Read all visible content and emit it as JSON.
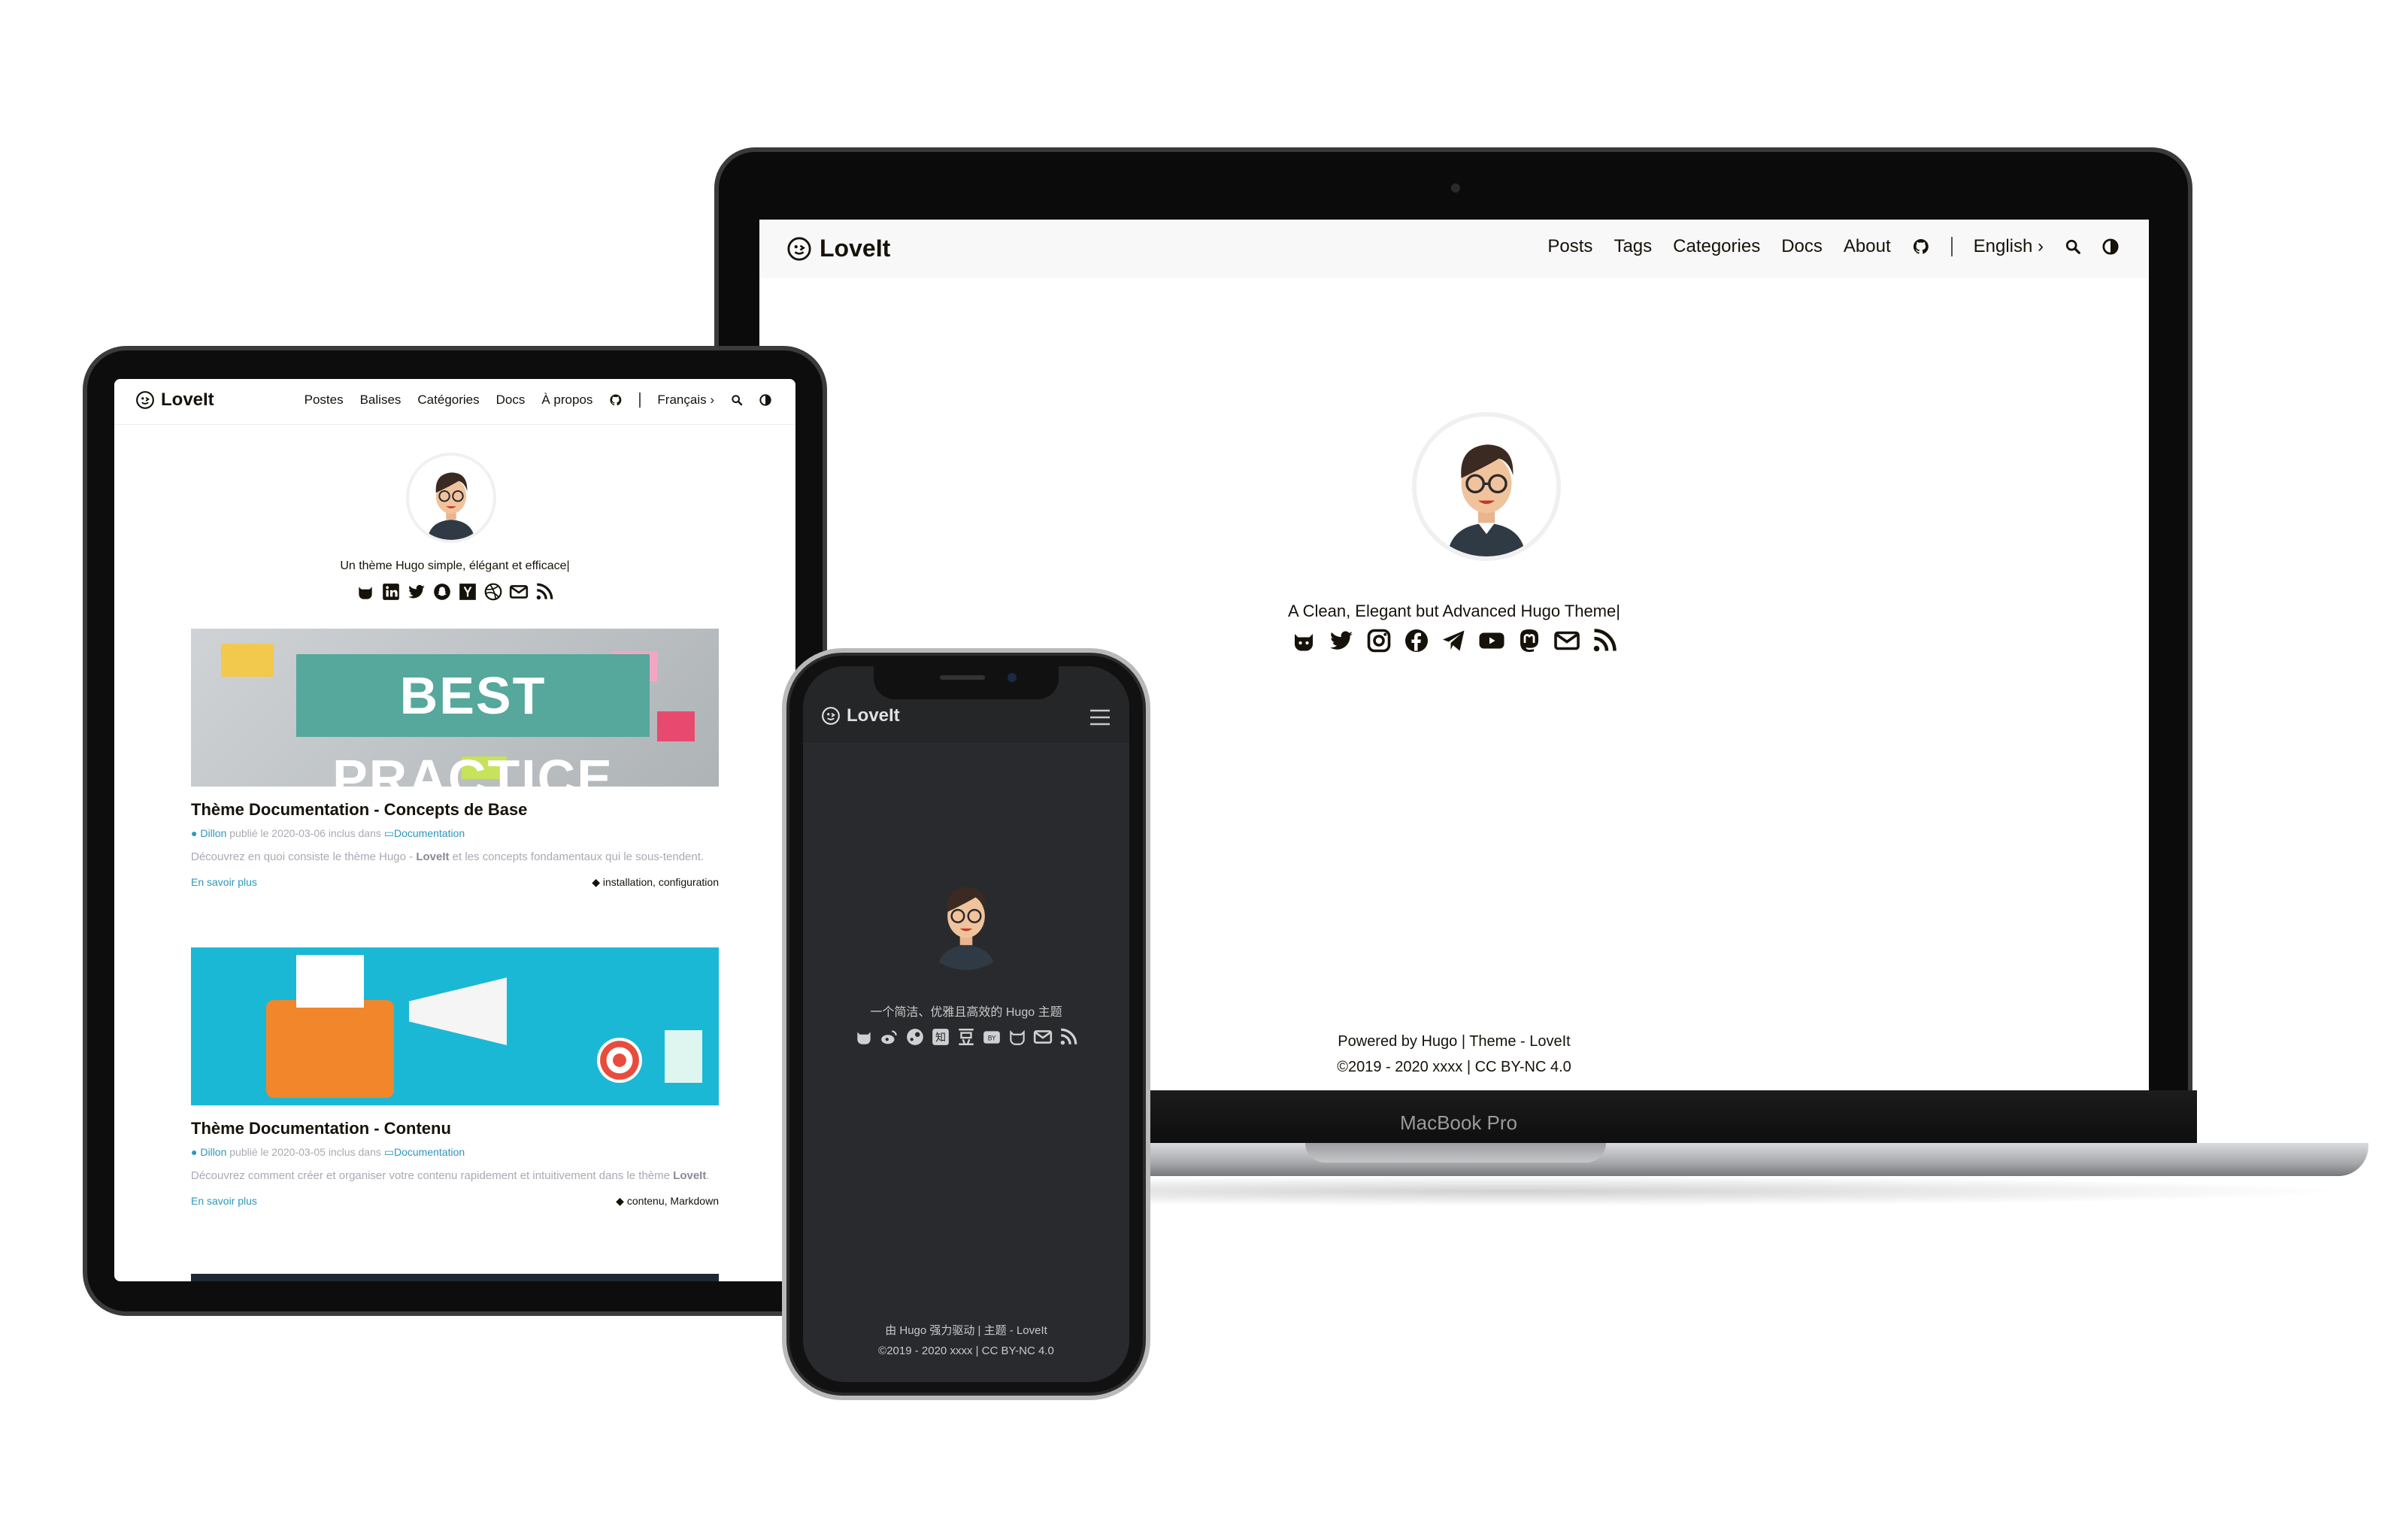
{
  "laptop": {
    "brand": "MacBook Pro",
    "logo": "LoveIt",
    "menu": [
      "Posts",
      "Tags",
      "Categories",
      "Docs",
      "About"
    ],
    "language": "English",
    "subtitle": "A Clean, Elegant but Advanced Hugo Theme|",
    "social_icons": [
      "github-icon",
      "twitter-icon",
      "instagram-icon",
      "facebook-icon",
      "telegram-icon",
      "youtube-icon",
      "mastodon-icon",
      "email-icon",
      "rss-icon"
    ],
    "footer_line1": "Powered by Hugo | Theme - LoveIt",
    "footer_line2": "©2019 - 2020 xxxx | CC BY-NC 4.0"
  },
  "tablet": {
    "logo": "LoveIt",
    "menu": [
      "Postes",
      "Balises",
      "Catégories",
      "Docs",
      "À propos"
    ],
    "language": "Français",
    "subtitle": "Un thème Hugo simple, élégant et efficace|",
    "social_icons": [
      "github-icon",
      "linkedin-icon",
      "twitter-icon",
      "snapchat-icon",
      "ycombinator-icon",
      "dribbble-icon",
      "email-icon",
      "rss-icon"
    ],
    "posts": [
      {
        "banner_text": "BEST PRACTICE",
        "title": "Thème Documentation - Concepts de Base",
        "author": "Dillon",
        "meta_published": "publié le 2020-03-06",
        "meta_included": "inclus dans",
        "category": "Documentation",
        "summary_before": "Découvrez en quoi consiste le thème Hugo - ",
        "summary_bold": "LoveIt",
        "summary_after": " et les concepts fondamentaux qui le sous-tendent.",
        "more": "En savoir plus",
        "tags": "installation, configuration"
      },
      {
        "banner_text": "",
        "title": "Thème Documentation - Contenu",
        "author": "Dillon",
        "meta_published": "publié le 2020-03-05",
        "meta_included": "inclus dans",
        "category": "Documentation",
        "summary_before": "Découvrez comment créer et organiser votre contenu rapidement et intuitivement dans le thème ",
        "summary_bold": "LoveIt",
        "summary_after": ".",
        "more": "En savoir plus",
        "tags": "contenu, Markdown"
      }
    ]
  },
  "phone": {
    "logo": "LoveIt",
    "subtitle": "一个简洁、优雅且高效的 Hugo 主题",
    "social_icons": [
      "github-icon",
      "weibo-icon",
      "steam-icon",
      "zhihu-icon",
      "douban-icon",
      "bilibili-icon",
      "github-alt-icon",
      "email-icon",
      "rss-icon"
    ],
    "footer_line1": "由 Hugo 强力驱动 | 主题 - LoveIt",
    "footer_line2": "©2019 - 2020 xxxx | CC BY-NC 4.0"
  },
  "colors": {
    "text": "#161209",
    "muted": "#a9a9b3",
    "link": "#2d96bd",
    "dark_bg": "#292a2d",
    "banner_teal": "#55a89b",
    "banner_cyan": "#1bb8d6"
  }
}
